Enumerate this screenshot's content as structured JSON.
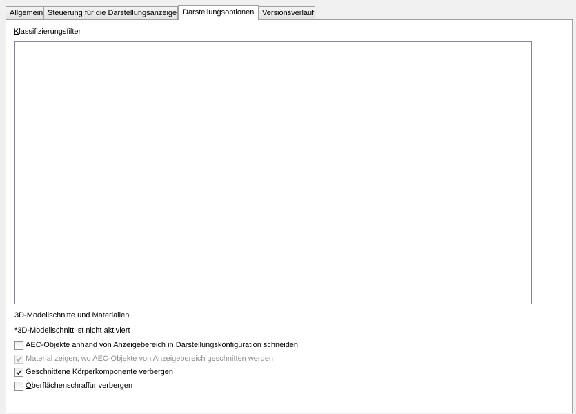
{
  "tabs": [
    {
      "label": "Allgemein",
      "active": false
    },
    {
      "label": "Steuerung für die Darstellungsanzeige",
      "active": false
    },
    {
      "label": "Darstellungsoptionen",
      "active": true
    },
    {
      "label": "Versionsverlauf",
      "active": false
    }
  ],
  "classification": {
    "label_mnemonic": "K",
    "label_rest": "lassifizierungsfilter"
  },
  "section": {
    "title": "3D-Modellschnitte und Materialien",
    "note": "*3D-Modellschnitt ist nicht aktiviert"
  },
  "options": [
    {
      "pre": "A",
      "mnemonic": "E",
      "post": "C-Objekte anhand von Anzeigebereich in Darstellungskonfiguration schneiden",
      "checked": false,
      "enabled": true
    },
    {
      "pre": "",
      "mnemonic": "M",
      "post": "aterial zeigen, wo AEC-Objekte von Anzeigebereich geschnitten werden",
      "checked": true,
      "enabled": false
    },
    {
      "pre": "",
      "mnemonic": "G",
      "post": "eschnittene Körperkomponente verbergen",
      "checked": true,
      "enabled": true
    },
    {
      "pre": "",
      "mnemonic": "O",
      "post": "berflächenschraffur verbergen",
      "checked": false,
      "enabled": true
    }
  ],
  "colors": {
    "panel_background": "#ffffff",
    "window_background": "#f0f0f0",
    "border": "#a0a0a0",
    "disabled_text": "#8d8d8d"
  }
}
